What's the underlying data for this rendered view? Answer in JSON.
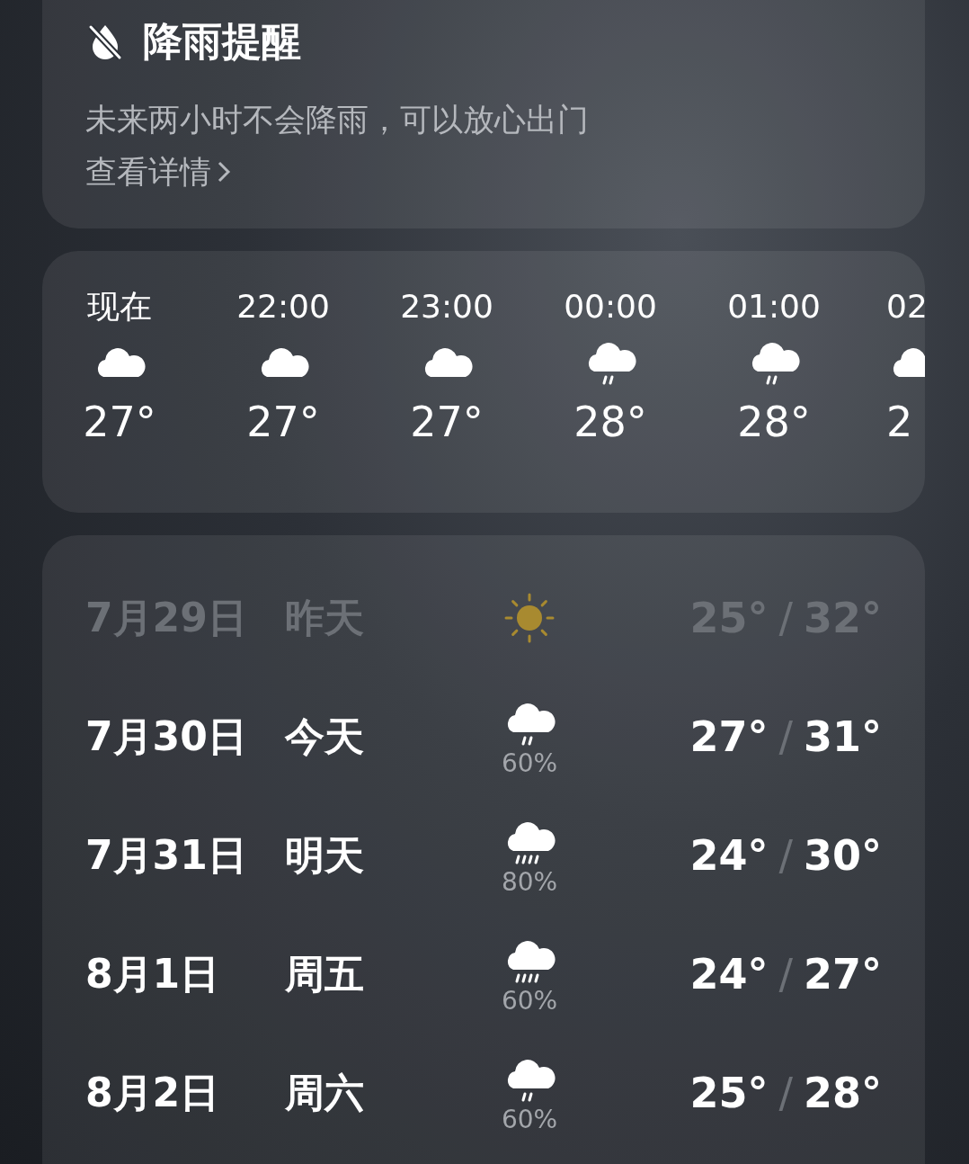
{
  "rain_alert": {
    "title": "降雨提醒",
    "message": "未来两小时不会降雨，可以放心出门",
    "link": "查看详情"
  },
  "hourly": [
    {
      "time": "现在",
      "kind": "cloud",
      "temp": "27°"
    },
    {
      "time": "22:00",
      "kind": "cloud",
      "temp": "27°"
    },
    {
      "time": "23:00",
      "kind": "cloud",
      "temp": "27°"
    },
    {
      "time": "00:00",
      "kind": "drizzle",
      "temp": "28°"
    },
    {
      "time": "01:00",
      "kind": "drizzle",
      "temp": "28°"
    },
    {
      "time": "02",
      "kind": "cloud",
      "temp": "2"
    }
  ],
  "daily": [
    {
      "date": "7月29日",
      "day": "昨天",
      "kind": "sun",
      "low": "25°",
      "sep": "/",
      "high": "32°",
      "past": true
    },
    {
      "date": "7月30日",
      "day": "今天",
      "kind": "drizzle",
      "precip": "60%",
      "low": "27°",
      "sep": "/",
      "high": "31°",
      "past": false
    },
    {
      "date": "7月31日",
      "day": "明天",
      "kind": "rain",
      "precip": "80%",
      "low": "24°",
      "sep": "/",
      "high": "30°",
      "past": false
    },
    {
      "date": "8月1日",
      "day": "周五",
      "kind": "rain",
      "precip": "60%",
      "low": "24°",
      "sep": "/",
      "high": "27°",
      "past": false
    },
    {
      "date": "8月2日",
      "day": "周六",
      "kind": "drizzle",
      "precip": "60%",
      "low": "25°",
      "sep": "/",
      "high": "28°",
      "past": false
    }
  ]
}
